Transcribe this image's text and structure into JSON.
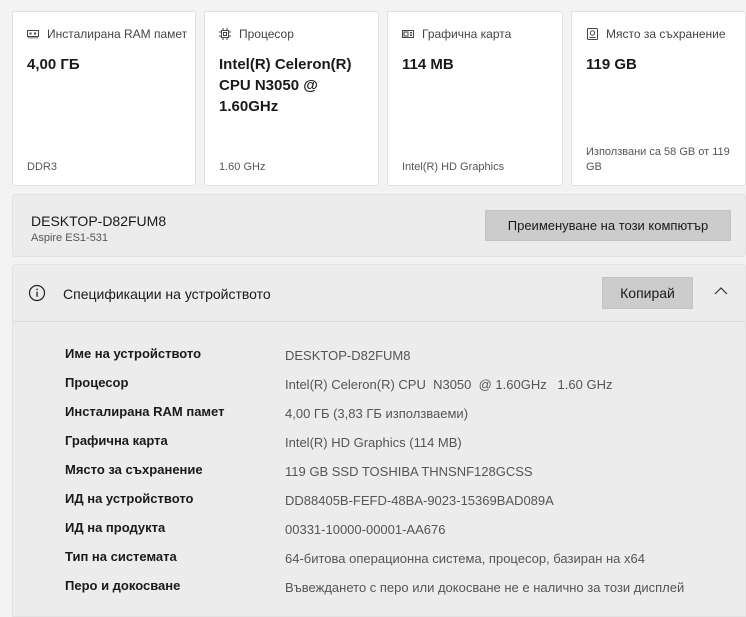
{
  "cards": [
    {
      "id": "ram",
      "icon": "ram-icon",
      "header": "Инсталирана RAM памет",
      "value": "4,00 ГБ",
      "sub": "DDR3"
    },
    {
      "id": "cpu",
      "icon": "processor-icon",
      "header": "Процесор",
      "value": "Intel(R) Celeron(R) CPU  N3050  @ 1.60GHz",
      "sub": "1.60 GHz"
    },
    {
      "id": "gpu",
      "icon": "graphics-card-icon",
      "header": "Графична карта",
      "value": "114 MB",
      "sub": "Intel(R) HD Graphics"
    },
    {
      "id": "storage",
      "icon": "storage-icon",
      "header": "Място за съхранение",
      "value": "119 GB",
      "sub": "Използвани са 58 GB от 119 GB"
    }
  ],
  "device": {
    "name": "DESKTOP-D82FUM8",
    "model": "Aspire ES1-531",
    "rename_label": "Преименуване на този компютър"
  },
  "specs": {
    "title": "Спецификации на устройството",
    "copy_label": "Копирай",
    "rows": [
      {
        "key": "Име на устройството",
        "value": "DESKTOP-D82FUM8"
      },
      {
        "key": "Процесор",
        "value": "Intel(R) Celeron(R) CPU  N3050  @ 1.60GHz   1.60 GHz"
      },
      {
        "key": "Инсталирана RAM памет",
        "value": "4,00 ГБ (3,83 ГБ използваеми)"
      },
      {
        "key": "Графична карта",
        "value": "Intel(R) HD Graphics (114 MB)"
      },
      {
        "key": "Място за съхранение",
        "value": "119 GB SSD TOSHIBA THNSNF128GCSS"
      },
      {
        "key": "ИД на устройството",
        "value": "DD88405B-FEFD-48BA-9023-15369BAD089A"
      },
      {
        "key": "ИД на продукта",
        "value": "00331-10000-00001-AA676"
      },
      {
        "key": "Тип на системата",
        "value": "64-битова операционна система, процесор, базиран на x64"
      },
      {
        "key": "Перо и докосване",
        "value": "Въвеждането с перо или докосване не е налично за този дисплей"
      }
    ]
  }
}
